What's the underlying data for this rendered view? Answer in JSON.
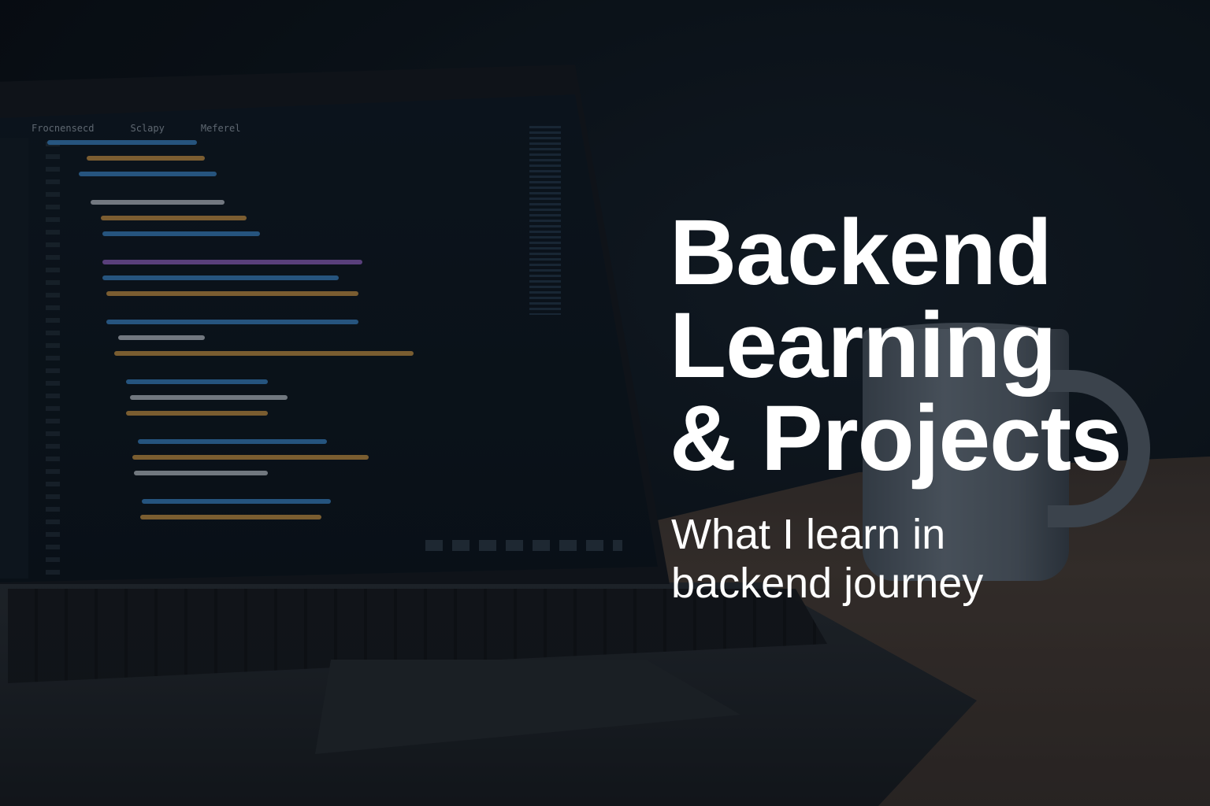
{
  "headline": {
    "line1": "Backend",
    "line2": "Learning",
    "line3": "& Projects"
  },
  "subtitle": {
    "line1": "What I learn in",
    "line2": "backend journey"
  },
  "photo": {
    "subject": "laptop with code editor and coffee mug on table",
    "editor_menu": [
      "Frocnensecd",
      "Sclapy",
      "Meferel"
    ]
  },
  "colors": {
    "background": "#0b1218",
    "text": "#ffffff",
    "code_accents": [
      "#3f8fd6",
      "#d8a04a",
      "#c8d0d8",
      "#9b6ad0"
    ]
  }
}
